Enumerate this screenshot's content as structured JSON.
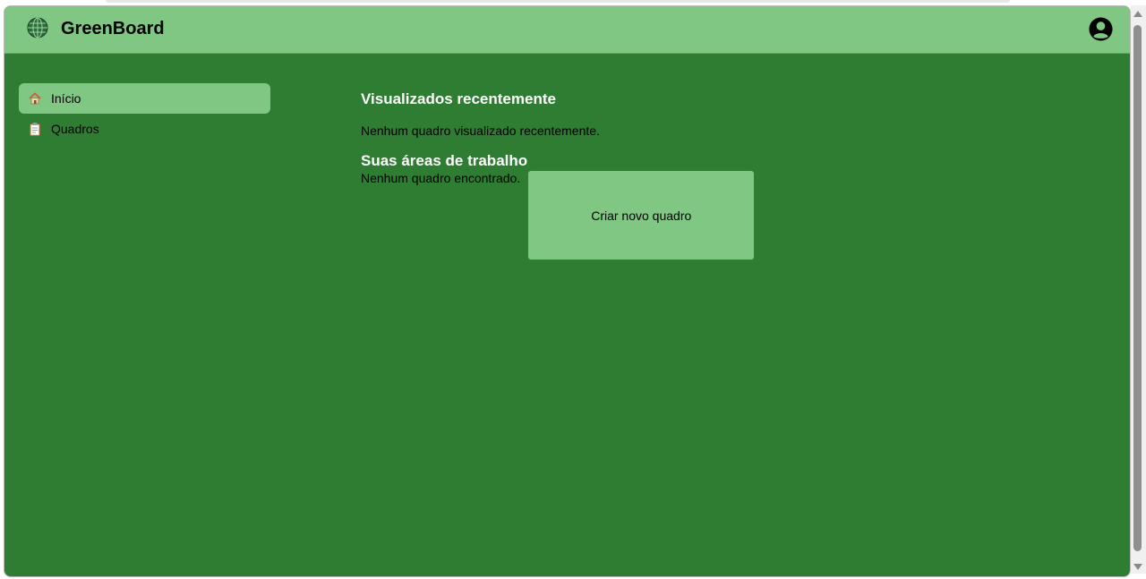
{
  "header": {
    "title": "GreenBoard",
    "logo_icon": "globe-icon",
    "profile_icon": "user-circle-icon"
  },
  "sidebar": {
    "items": [
      {
        "label": "Início",
        "icon": "home-icon",
        "active": true
      },
      {
        "label": "Quadros",
        "icon": "clipboard-icon",
        "active": false
      }
    ]
  },
  "main": {
    "recent_title": "Visualizados recentemente",
    "recent_empty": "Nenhum quadro visualizado recentemente.",
    "workspaces_title": "Suas áreas de trabalho",
    "workspaces_empty": "Nenhum quadro encontrado.",
    "create_board_label": "Criar novo quadro"
  },
  "colors": {
    "header_bg": "#81c784",
    "page_bg": "#2f7d32",
    "accent": "#81c784"
  }
}
